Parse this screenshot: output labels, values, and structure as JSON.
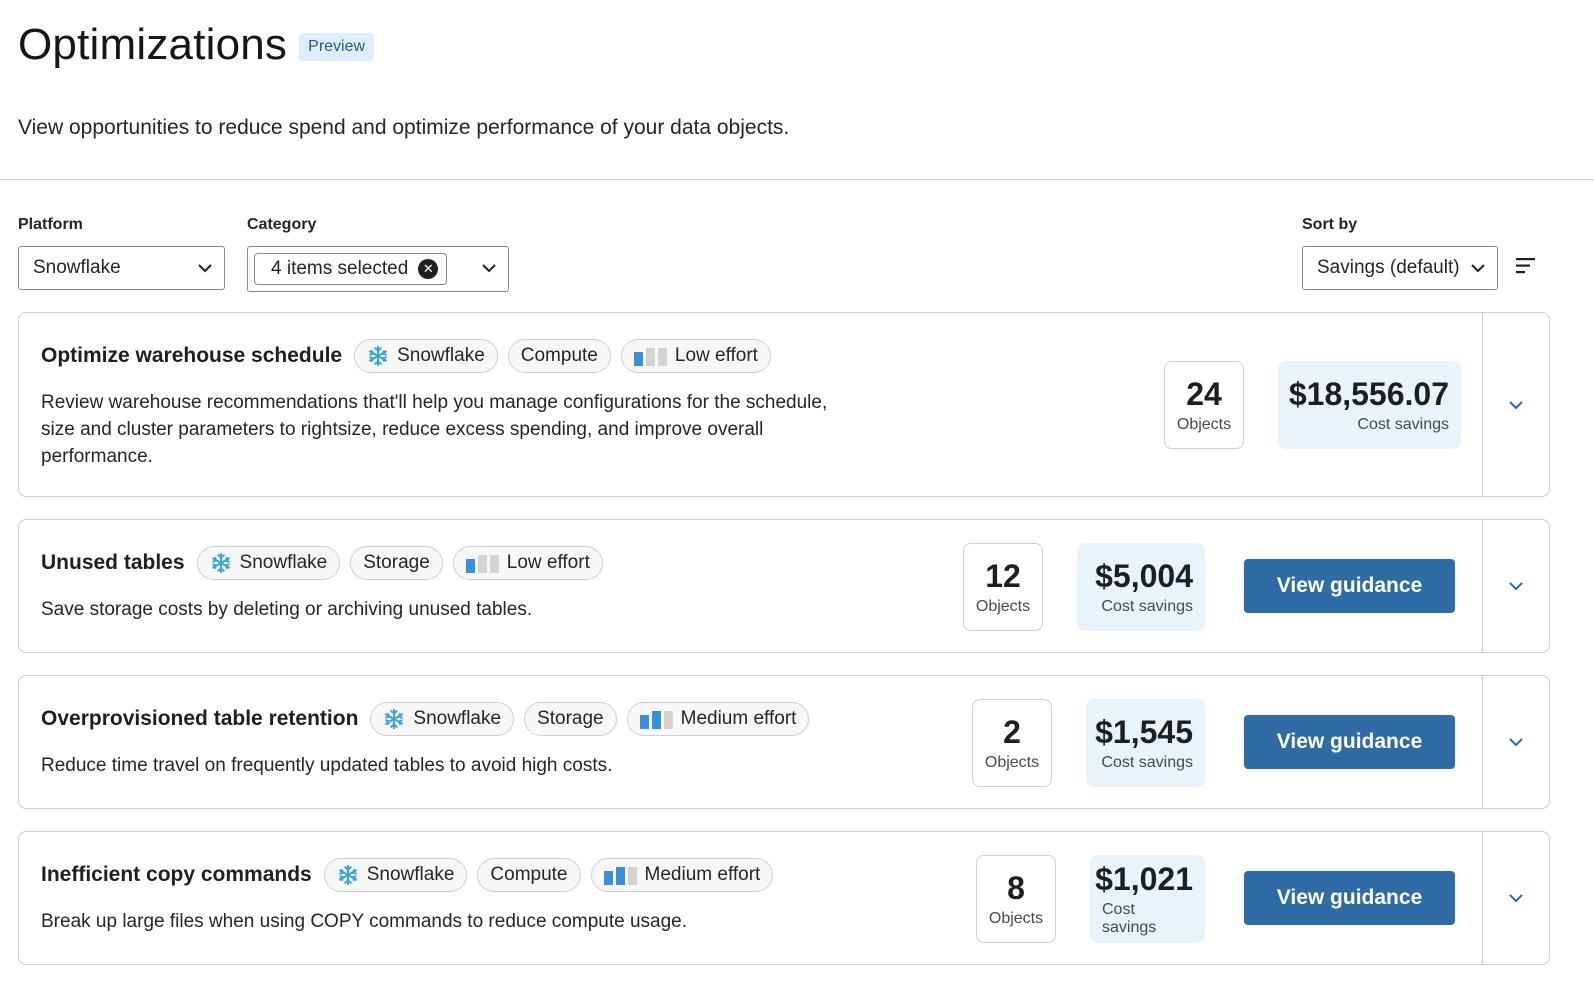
{
  "page": {
    "title": "Optimizations",
    "badge": "Preview",
    "subtitle": "View opportunities to reduce spend and optimize performance of your data objects."
  },
  "filters": {
    "platform": {
      "label": "Platform",
      "value": "Snowflake"
    },
    "category": {
      "label": "Category",
      "value": "4 items selected"
    },
    "sort": {
      "label": "Sort by",
      "value": "Savings (default)"
    }
  },
  "colors": {
    "accent": "#2f6ca6",
    "savings_bg": "#e8f3fc",
    "effort_on": "#3b8ed8",
    "effort_off": "#d3d3d3",
    "badge_bg": "#dceefb"
  },
  "cards": [
    {
      "title": "Optimize warehouse schedule",
      "platform_tag": "Snowflake",
      "category_tag": "Compute",
      "effort_tag": "Low effort",
      "effort_level": 1,
      "description_lines": [
        "Review warehouse recommendations that'll help you manage configurations for the schedule,",
        "size and cluster parameters to rightsize, reduce excess spending, and improve overall",
        "performance."
      ],
      "objects": "24",
      "objects_label": "Objects",
      "savings": "$18,556.07",
      "savings_label": "Cost savings",
      "button": ""
    },
    {
      "title": "Unused tables",
      "platform_tag": "Snowflake",
      "category_tag": "Storage",
      "effort_tag": "Low effort",
      "effort_level": 1,
      "description_lines": [
        "Save storage costs by deleting or archiving unused tables."
      ],
      "objects": "12",
      "objects_label": "Objects",
      "savings": "$5,004",
      "savings_label": "Cost savings",
      "button": "View guidance"
    },
    {
      "title": "Overprovisioned table retention",
      "platform_tag": "Snowflake",
      "category_tag": "Storage",
      "effort_tag": "Medium effort",
      "effort_level": 2,
      "description_lines": [
        "Reduce time travel on frequently updated tables to avoid high costs."
      ],
      "objects": "2",
      "objects_label": "Objects",
      "savings": "$1,545",
      "savings_label": "Cost savings",
      "button": "View guidance"
    },
    {
      "title": "Inefficient copy commands",
      "platform_tag": "Snowflake",
      "category_tag": "Compute",
      "effort_tag": "Medium effort",
      "effort_level": 2,
      "description_lines": [
        "Break up large files when using COPY commands to reduce compute usage."
      ],
      "objects": "8",
      "objects_label": "Objects",
      "savings": "$1,021",
      "savings_label": "Cost savings",
      "button": "View guidance"
    }
  ]
}
